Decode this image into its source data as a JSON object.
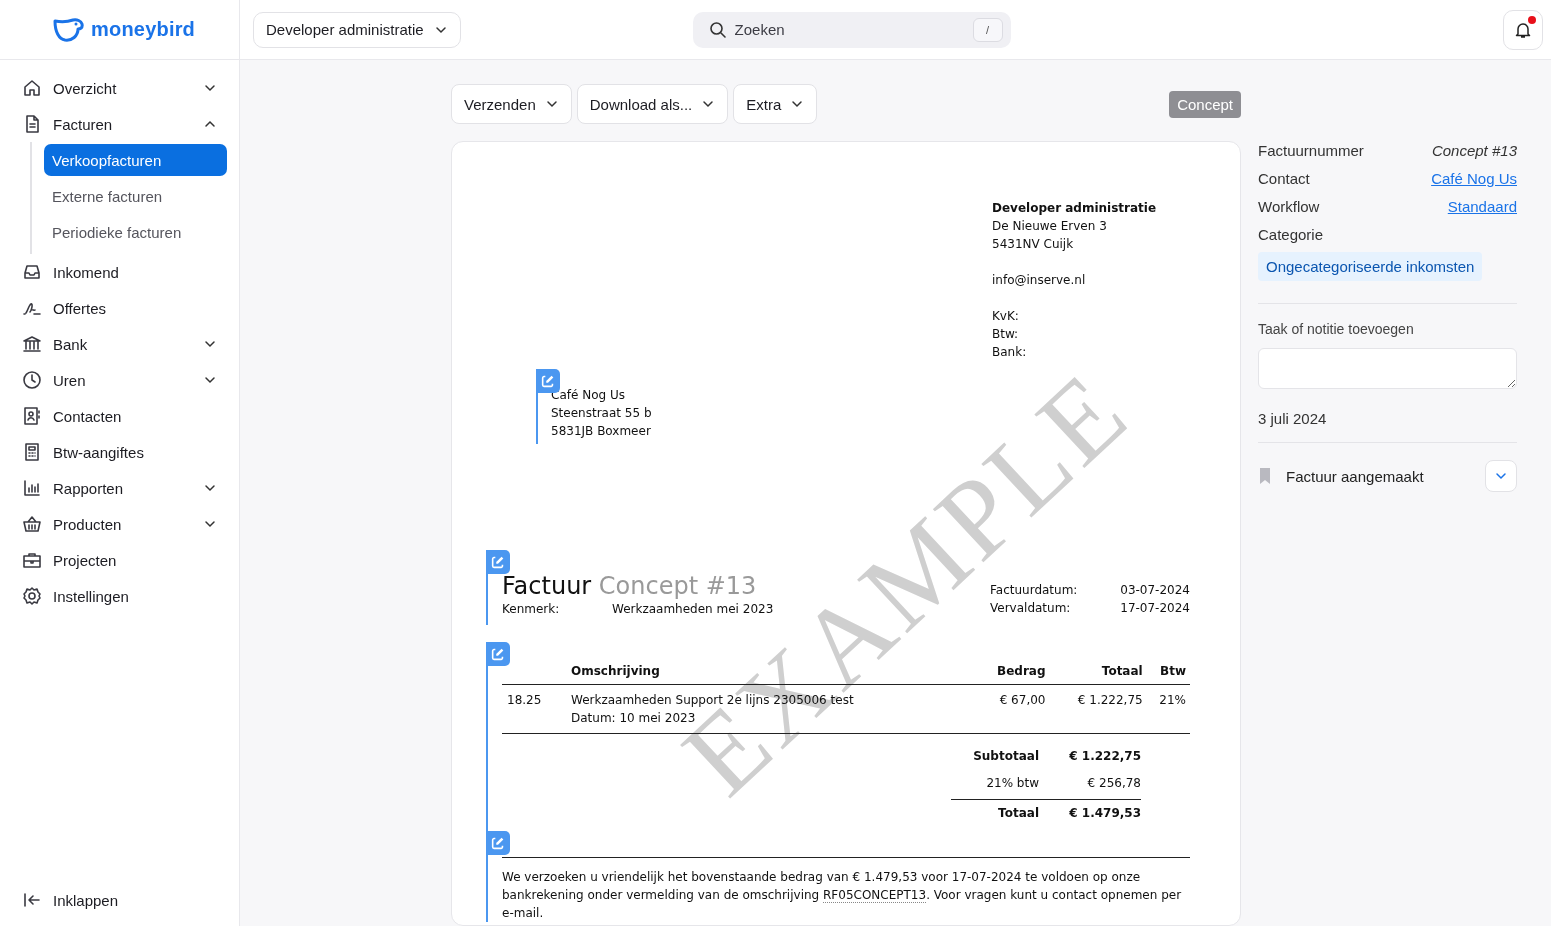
{
  "header": {
    "logo_text": "moneybird",
    "administration": "Developer administratie",
    "search": {
      "placeholder": "Zoeken",
      "shortcut": "/"
    },
    "notifications": {
      "unread": true
    }
  },
  "sidebar": {
    "items": [
      {
        "label": "Overzicht",
        "expanded": false
      },
      {
        "label": "Facturen",
        "expanded": true,
        "children": [
          {
            "label": "Verkoopfacturen",
            "selected": true
          },
          {
            "label": "Externe facturen",
            "selected": false
          },
          {
            "label": "Periodieke facturen",
            "selected": false
          }
        ]
      },
      {
        "label": "Inkomend"
      },
      {
        "label": "Offertes"
      },
      {
        "label": "Bank",
        "expanded": false
      },
      {
        "label": "Uren",
        "expanded": false
      },
      {
        "label": "Contacten"
      },
      {
        "label": "Btw-aangiftes"
      },
      {
        "label": "Rapporten",
        "expanded": false
      },
      {
        "label": "Producten",
        "expanded": false
      },
      {
        "label": "Projecten"
      },
      {
        "label": "Instellingen"
      }
    ],
    "collapse_label": "Inklappen"
  },
  "toolbar": {
    "buttons": [
      "Verzenden",
      "Download als...",
      "Extra"
    ],
    "status": "Concept"
  },
  "invoice": {
    "watermark": "EXAMPLE",
    "sender": {
      "name": "Developer administratie",
      "address": [
        "De Nieuwe Erven 3",
        "5431NV Cuijk"
      ],
      "email": "info@inserve.nl",
      "registration": [
        "KvK:",
        "Btw:",
        "Bank:"
      ]
    },
    "recipient": [
      "Café Nog Us",
      "Steenstraat 55 b",
      "5831JB Boxmeer"
    ],
    "title": "Factuur",
    "number": "Concept #13",
    "reference_label": "Kenmerk:",
    "reference": "Werkzaamheden mei 2023",
    "dates": [
      {
        "label": "Factuurdatum:",
        "value": "03-07-2024"
      },
      {
        "label": "Vervaldatum:",
        "value": "17-07-2024"
      }
    ],
    "table": {
      "columns": [
        "Omschrijving",
        "Bedrag",
        "Totaal",
        "Btw"
      ],
      "rows": [
        {
          "quantity": "18.25",
          "description": [
            "Werkzaamheden Support 2e lijns 2305006 test",
            "Datum: 10 mei 2023"
          ],
          "price": "€ 67,00",
          "total": "€ 1.222,75",
          "vat": "21%"
        }
      ]
    },
    "totals": [
      {
        "kind": "subtotal",
        "label": "Subtotaal",
        "value": "€ 1.222,75"
      },
      {
        "kind": "tax",
        "label": "21% btw",
        "value": "€ 256,78"
      },
      {
        "kind": "total",
        "label": "Totaal",
        "value": "€ 1.479,53"
      }
    ],
    "payment_note": {
      "before": "We verzoeken u vriendelijk het bovenstaande bedrag van € 1.479,53 voor 17-07-2024 te voldoen op onze bankrekening onder vermelding van de omschrijving ",
      "reference": "RF05CONCEPT13",
      "after": ". Voor vragen kunt u contact opnemen per e-mail."
    }
  },
  "details": {
    "fields": [
      {
        "kind": "text",
        "label": "Factuurnummer",
        "value": "Concept #13"
      },
      {
        "kind": "link",
        "label": "Contact",
        "value": "Café Nog Us"
      },
      {
        "kind": "link",
        "label": "Workflow",
        "value": "Standaard"
      }
    ],
    "category": {
      "label": "Categorie",
      "value": "Ongecategoriseerde inkomsten"
    },
    "note": {
      "label": "Taak of notitie toevoegen"
    },
    "timeline": {
      "date": "3 juli 2024",
      "events": [
        {
          "label": "Factuur aangemaakt",
          "expanded": false
        }
      ]
    }
  }
}
